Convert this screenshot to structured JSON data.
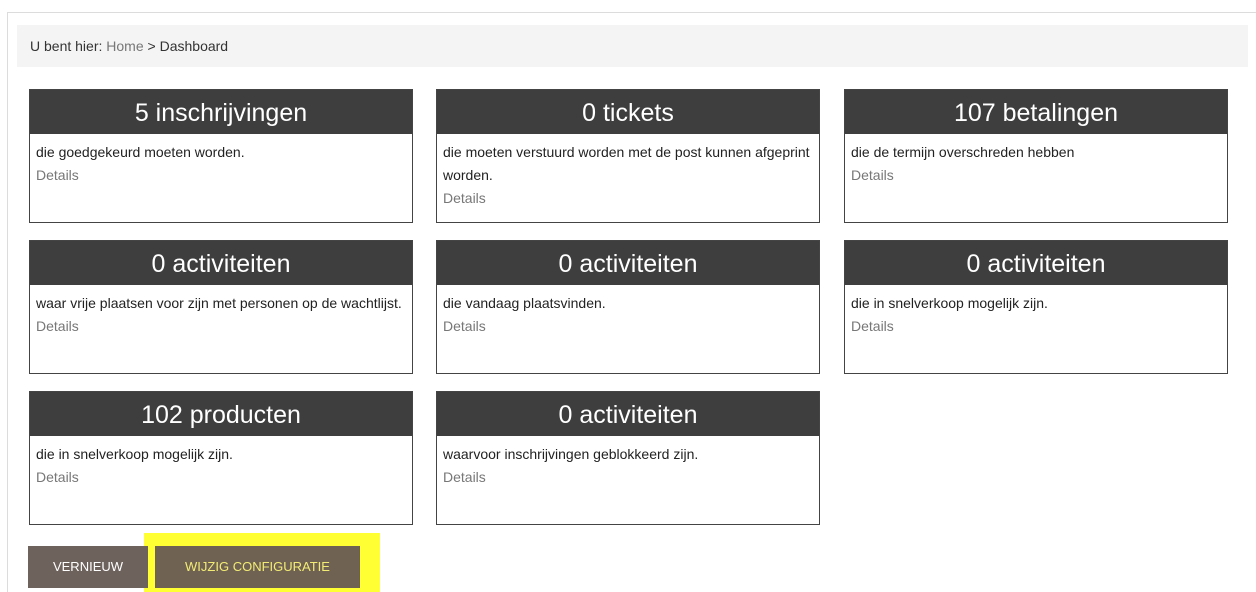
{
  "breadcrumb": {
    "prefix": "U bent hier:",
    "home": "Home",
    "separator": ">",
    "current": "Dashboard"
  },
  "cards": [
    {
      "title": "5 inschrijvingen",
      "text": "die goedgekeurd moeten worden.",
      "details": "Details"
    },
    {
      "title": "0 tickets",
      "text": "die moeten verstuurd worden met de post kunnen afgeprint worden.",
      "details": "Details"
    },
    {
      "title": "107 betalingen",
      "text": "die de termijn overschreden hebben",
      "details": "Details"
    },
    {
      "title": "0 activiteiten",
      "text": "waar vrije plaatsen voor zijn met personen op de wachtlijst.",
      "details": "Details"
    },
    {
      "title": "0 activiteiten",
      "text": "die vandaag plaatsvinden.",
      "details": "Details"
    },
    {
      "title": "0 activiteiten",
      "text": "die in snelverkoop mogelijk zijn.",
      "details": "Details"
    },
    {
      "title": "102 producten",
      "text": "die in snelverkoop mogelijk zijn.",
      "details": "Details"
    },
    {
      "title": "0 activiteiten",
      "text": "waarvoor inschrijvingen geblokkeerd zijn.",
      "details": "Details"
    }
  ],
  "actions": {
    "refresh_label": "VERNIEUW",
    "config_label": "WIJZIG CONFIGURATIE"
  },
  "colors": {
    "card_header_bg": "#3e3e3e",
    "button_bg": "#6e625c",
    "highlight": "#ffff33",
    "link": "#777777"
  }
}
